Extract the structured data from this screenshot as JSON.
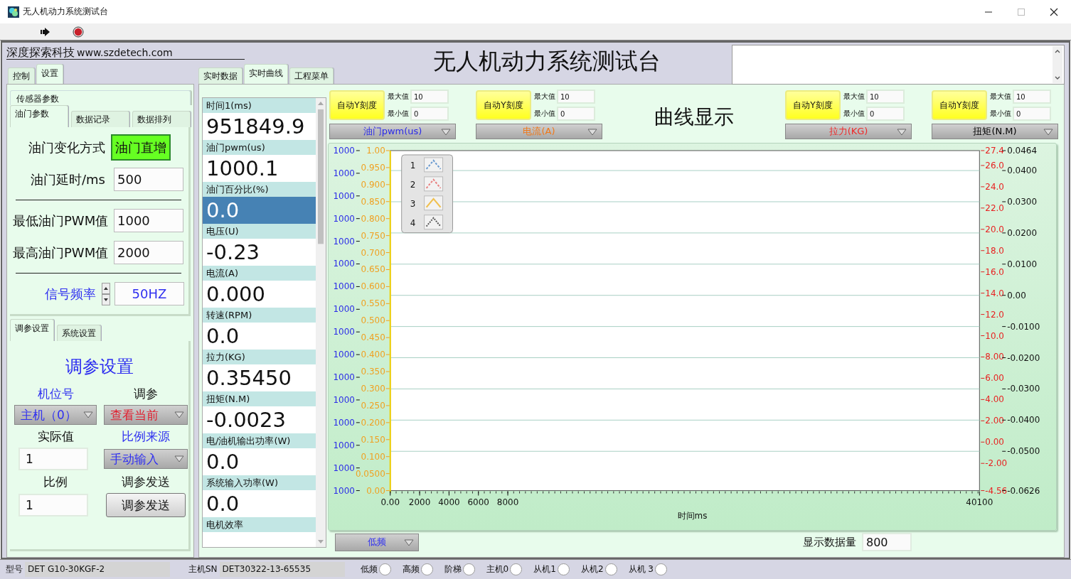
{
  "window": {
    "title": "无人机动力系统测试台"
  },
  "header": {
    "brand": "深度探索科技",
    "website": "www.szdetech.com",
    "title": "无人机动力系统测试台"
  },
  "left_tabs": [
    {
      "label": "控制",
      "selected": false
    },
    {
      "label": "设置",
      "selected": true
    }
  ],
  "sensor_group": {
    "title": "传感器参数",
    "tabs": [
      {
        "label": "油门参数",
        "selected": true
      },
      {
        "label": "数据记录",
        "selected": false
      },
      {
        "label": "数据排列",
        "selected": false
      }
    ]
  },
  "throttle": {
    "mode_label": "油门变化方式",
    "mode_button": "油门直增",
    "delay_label": "油门延时/ms",
    "delay_value": "500",
    "min_pwm_label": "最低油门PWM值",
    "min_pwm_value": "1000",
    "max_pwm_label": "最高油门PWM值",
    "max_pwm_value": "2000",
    "freq_label": "信号频率",
    "freq_value": "50HZ"
  },
  "tuning_tabs": [
    {
      "label": "调参设置",
      "selected": true
    },
    {
      "label": "系统设置",
      "selected": false
    }
  ],
  "tuning": {
    "title": "调参设置",
    "station_label": "机位号",
    "station_value": "主机（0）",
    "param_label": "调参",
    "param_value": "查看当前",
    "actual_label": "实际值",
    "actual_value": "1",
    "source_label": "比例来源",
    "source_value": "手动输入",
    "ratio_label": "比例",
    "ratio_value": "1",
    "send_label": "调参发送",
    "send_button": "调参发送"
  },
  "center_tabs": [
    {
      "label": "实时数据",
      "selected": false
    },
    {
      "label": "实时曲线",
      "selected": true
    },
    {
      "label": "工程菜单",
      "selected": false
    }
  ],
  "readings": [
    {
      "label": "时间1(ms)",
      "value": "951849.9",
      "selected": false
    },
    {
      "label": "油门pwm(us)",
      "value": "1000.1",
      "selected": false
    },
    {
      "label": "油门百分比(%)",
      "value": "0.0",
      "selected": true
    },
    {
      "label": "电压(U)",
      "value": "-0.23",
      "selected": false
    },
    {
      "label": "电流(A)",
      "value": "0.000",
      "selected": false
    },
    {
      "label": "转速(RPM)",
      "value": "0.0",
      "selected": false
    },
    {
      "label": "拉力(KG)",
      "value": "0.35450",
      "selected": false
    },
    {
      "label": "扭矩(N.M)",
      "value": "-0.0023",
      "selected": false
    },
    {
      "label": "电/油机输出功率(W)",
      "value": "0.0",
      "selected": false
    },
    {
      "label": "系统输入功率(W)",
      "value": "0.0",
      "selected": false
    },
    {
      "label": "电机效率",
      "selected": false
    }
  ],
  "curve_panel": {
    "title": "曲线显示",
    "scales": [
      {
        "button": "自动Y刻度",
        "max_label": "最大值",
        "max_value": "10",
        "min_label": "最小值",
        "min_value": "0",
        "channel": "油门pwm(us)",
        "color": "#2a2ae8"
      },
      {
        "button": "自动Y刻度",
        "max_label": "最大值",
        "max_value": "10",
        "min_label": "最小值",
        "min_value": "0",
        "channel": "电流(A)",
        "color": "#f07818"
      },
      {
        "button": "自动Y刻度",
        "max_label": "最大值",
        "max_value": "10",
        "min_label": "最小值",
        "min_value": "0",
        "channel": "拉力(KG)",
        "color": "#ee2a2a"
      },
      {
        "button": "自动Y刻度",
        "max_label": "最大值",
        "max_value": "10",
        "min_label": "最小值",
        "min_value": "0",
        "channel": "扭矩(N.M)",
        "color": "#000000"
      }
    ]
  },
  "chart": {
    "x_axis": {
      "title": "时间ms",
      "tick_labels": [
        "0.00",
        "2000",
        "4000",
        "6000",
        "8000",
        "40100"
      ]
    },
    "left_outer_axis_labels": [
      "1000",
      "1000",
      "1000",
      "1000",
      "1000",
      "1000",
      "1000",
      "1000",
      "1000",
      "1000",
      "1000",
      "1000",
      "1000",
      "1000",
      "1000",
      "1000"
    ],
    "left_axis_labels": [
      "1.00",
      "0.950",
      "0.900",
      "0.850",
      "0.800",
      "0.750",
      "0.700",
      "0.650",
      "0.600",
      "0.550",
      "0.500",
      "0.450",
      "0.400",
      "0.350",
      "0.300",
      "0.250",
      "0.200",
      "0.150",
      "0.100",
      "0.0500",
      "0.00"
    ],
    "right_axis_labels": [
      "27.4",
      "26.0",
      "24.0",
      "22.0",
      "20.0",
      "18.0",
      "16.0",
      "14.0",
      "12.0",
      "10.0",
      "8.00",
      "6.00",
      "4.00",
      "2.00",
      "0.00",
      "-2.00",
      "-4.56"
    ],
    "right_outer_axis_labels": [
      "0.0464",
      "0.0400",
      "0.0300",
      "0.0200",
      "0.0100",
      "0.00",
      "-0.0100",
      "-0.0200",
      "-0.0300",
      "-0.0400",
      "-0.0500",
      "-0.0626"
    ],
    "legend": [
      {
        "label": "1",
        "color": "#6a9ad0",
        "kind": "dashed"
      },
      {
        "label": "2",
        "color": "#e88080",
        "kind": "dashed"
      },
      {
        "label": "3",
        "color": "#f0c050",
        "kind": "solid"
      },
      {
        "label": "4",
        "color": "#555555",
        "kind": "dotted"
      }
    ]
  },
  "bottom": {
    "mode_value": "低频",
    "count_label": "显示数据量",
    "count_value": "800"
  },
  "status_bar": {
    "model_label": "型号",
    "model_value": "DET G10-30KGF-2",
    "sn_label": "主机SN",
    "sn_value": "DET30322-13-65535",
    "indicators": [
      {
        "label": "低频",
        "on": false
      },
      {
        "label": "高频",
        "on": false
      },
      {
        "label": "阶梯",
        "on": false
      },
      {
        "label": "主机0",
        "on": false
      },
      {
        "label": "从机1",
        "on": false
      },
      {
        "label": "从机2",
        "on": false
      },
      {
        "label": "从机 3",
        "on": false
      }
    ]
  }
}
